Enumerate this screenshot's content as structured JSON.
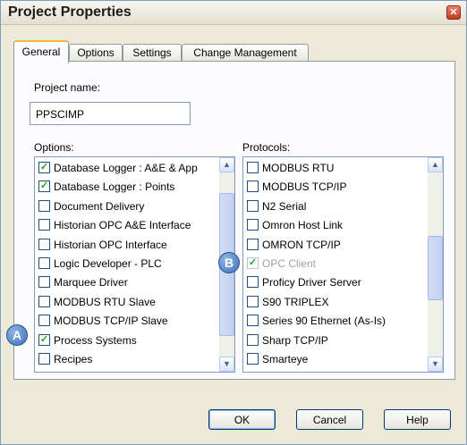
{
  "window": {
    "title": "Project Properties",
    "close_glyph": "✕"
  },
  "tabs": [
    {
      "label": "General",
      "active": true
    },
    {
      "label": "Options",
      "active": false
    },
    {
      "label": "Settings",
      "active": false
    },
    {
      "label": "Change Management",
      "active": false
    }
  ],
  "general": {
    "project_name_label": "Project name:",
    "project_name_value": "PPSCIMP",
    "options_label": "Options:",
    "protocols_label": "Protocols:"
  },
  "options_items": [
    {
      "label": "Database Logger : A&E & App",
      "checked": true,
      "disabled": false
    },
    {
      "label": "Database Logger : Points",
      "checked": true,
      "disabled": false
    },
    {
      "label": "Document Delivery",
      "checked": false,
      "disabled": false
    },
    {
      "label": "Historian OPC A&E Interface",
      "checked": false,
      "disabled": false
    },
    {
      "label": "Historian OPC Interface",
      "checked": false,
      "disabled": false
    },
    {
      "label": "Logic Developer - PLC",
      "checked": false,
      "disabled": false
    },
    {
      "label": "Marquee Driver",
      "checked": false,
      "disabled": false
    },
    {
      "label": "MODBUS RTU Slave",
      "checked": false,
      "disabled": false
    },
    {
      "label": "MODBUS TCP/IP Slave",
      "checked": false,
      "disabled": false
    },
    {
      "label": "Process Systems",
      "checked": true,
      "disabled": false
    },
    {
      "label": "Recipes",
      "checked": false,
      "disabled": false
    }
  ],
  "protocol_items": [
    {
      "label": "MODBUS RTU",
      "checked": false,
      "disabled": false
    },
    {
      "label": "MODBUS TCP/IP",
      "checked": false,
      "disabled": false
    },
    {
      "label": "N2 Serial",
      "checked": false,
      "disabled": false
    },
    {
      "label": "Omron Host Link",
      "checked": false,
      "disabled": false
    },
    {
      "label": "OMRON TCP/IP",
      "checked": false,
      "disabled": false
    },
    {
      "label": "OPC Client",
      "checked": true,
      "disabled": true
    },
    {
      "label": "Proficy Driver Server",
      "checked": false,
      "disabled": false
    },
    {
      "label": "S90 TRIPLEX",
      "checked": false,
      "disabled": false
    },
    {
      "label": "Series 90 Ethernet (As-Is)",
      "checked": false,
      "disabled": false
    },
    {
      "label": "Sharp TCP/IP",
      "checked": false,
      "disabled": false
    },
    {
      "label": "Smarteye",
      "checked": false,
      "disabled": false
    }
  ],
  "callouts": {
    "a": "A",
    "b": "B"
  },
  "buttons": {
    "ok": "OK",
    "cancel": "Cancel",
    "help": "Help"
  },
  "scroll_glyphs": {
    "up": "▲",
    "down": "▼"
  },
  "check_glyph": "✓"
}
